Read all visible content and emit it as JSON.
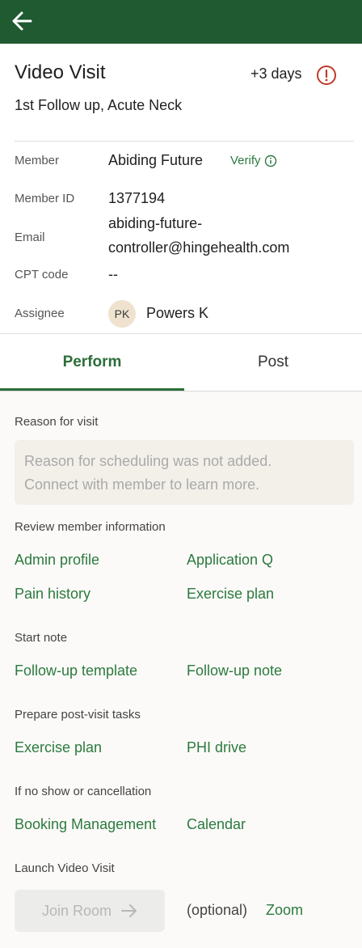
{
  "header": {
    "back_icon": "arrow-left-icon"
  },
  "visit": {
    "title": "Video Visit",
    "due": "+3 days",
    "alert_icon": "alert-circle-icon",
    "subtitle": "1st Follow up, Acute Neck"
  },
  "details": {
    "member_label": "Member",
    "member_value": "Abiding Future",
    "verify_label": "Verify",
    "member_id_label": "Member ID",
    "member_id_value": "1377194",
    "email_label": "Email",
    "email_line1": "abiding-future-",
    "email_line2": "controller@hingehealth.com",
    "cpt_label": "CPT code",
    "cpt_value": "--",
    "assignee_label": "Assignee",
    "assignee_initials": "PK",
    "assignee_name": "Powers K"
  },
  "tabs": [
    {
      "label": "Perform",
      "active": true
    },
    {
      "label": "Post",
      "active": false
    }
  ],
  "perform": {
    "reason_heading": "Reason for visit",
    "reason_line1": "Reason for scheduling was not added.",
    "reason_line2": "Connect with member to learn more.",
    "review_heading": "Review member information",
    "admin_profile": "Admin profile",
    "application_q": "Application Q",
    "pain_history": "Pain history",
    "exercise_plan_review": "Exercise plan",
    "start_note_heading": "Start note",
    "followup_template": "Follow-up template",
    "followup_note": "Follow-up note",
    "prepare_heading": "Prepare post-visit tasks",
    "exercise_plan_prepare": "Exercise plan",
    "phi_drive": "PHI drive",
    "noshow_heading": "If no show or cancellation",
    "booking_management": "Booking Management",
    "calendar": "Calendar",
    "launch_heading": "Launch Video Visit",
    "join_room": "Join Room",
    "optional": "(optional)",
    "zoom": "Zoom"
  },
  "colors": {
    "header_bg": "#1f5a31",
    "accent_green": "#2c7a3f",
    "alert_red": "#c0392b"
  }
}
